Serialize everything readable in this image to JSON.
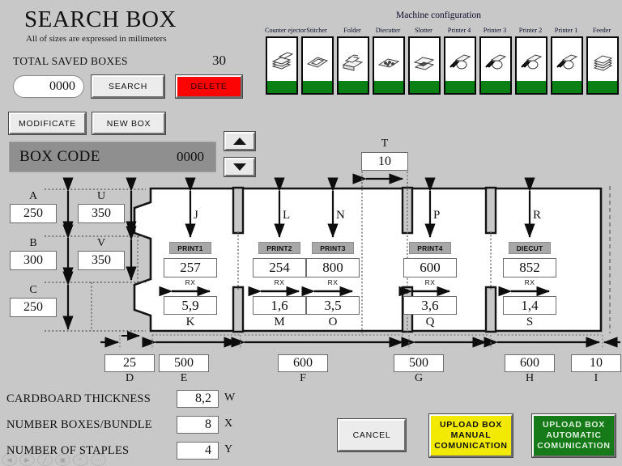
{
  "header": {
    "title": "SEARCH BOX",
    "subtitle": "All of sizes are expressed in milimeters",
    "total_label": "TOTAL SAVED BOXES",
    "total_value": "30"
  },
  "search": {
    "code_value": "0000",
    "code_placeholder": "0000",
    "search_label": "SEARCH",
    "delete_label": "DELETE",
    "delete_color": "#fc0404"
  },
  "actions": {
    "modificate_label": "MODIFICATE",
    "newbox_label": "NEW BOX",
    "cancel_label": "CANCEL",
    "upload_manual_label": "UPLOAD BOX MANUAL COMUNICATION",
    "upload_manual_lines": [
      "UPLOAD BOX",
      "MANUAL",
      "COMUNICATION"
    ],
    "upload_auto_label": "UPLOAD BOX AUTOMATIC COMUNICATION",
    "upload_auto_lines": [
      "UPLOAD BOX",
      "AUTOMATIC",
      "COMUNICATION"
    ],
    "upload_manual_color": "#f2ea03",
    "upload_auto_color": "#157a17"
  },
  "boxcode": {
    "label": "BOX CODE",
    "value": "0000",
    "spin_up_icon": "triangle-up-icon",
    "spin_down_icon": "triangle-down-icon"
  },
  "machine_config": {
    "title": "Machine configuration",
    "status_color": "#0b8014",
    "units": [
      {
        "name": "Counter ejector",
        "icon": "stacked-sheets-icon",
        "status": "ok"
      },
      {
        "name": "Stitcher",
        "icon": "stitcher-icon",
        "status": "ok"
      },
      {
        "name": "Folder",
        "icon": "folder-unit-icon",
        "status": "ok"
      },
      {
        "name": "Diecutter",
        "icon": "diecutter-icon",
        "status": "ok"
      },
      {
        "name": "Slotter",
        "icon": "slotter-icon",
        "status": "ok"
      },
      {
        "name": "Printer 4",
        "icon": "printer-unit-icon",
        "status": "ok"
      },
      {
        "name": "Printer 3",
        "icon": "printer-unit-icon",
        "status": "ok"
      },
      {
        "name": "Printer 2",
        "icon": "printer-unit-icon",
        "status": "ok"
      },
      {
        "name": "Printer 1",
        "icon": "printer-unit-icon",
        "status": "ok"
      },
      {
        "name": "Feeder",
        "icon": "feeder-stack-icon",
        "status": "ok"
      }
    ]
  },
  "dimensions": {
    "left": [
      {
        "tag": "A",
        "value": "250"
      },
      {
        "tag": "B",
        "value": "300"
      },
      {
        "tag": "C",
        "value": "250"
      }
    ],
    "inner_left": [
      {
        "tag": "U",
        "value": "350"
      },
      {
        "tag": "V",
        "value": "350"
      }
    ],
    "top": {
      "tag": "T",
      "value": "10"
    },
    "bottom": [
      {
        "tag": "D",
        "value": "25"
      },
      {
        "tag": "E",
        "value": "500"
      },
      {
        "tag": "F",
        "value": "600"
      },
      {
        "tag": "G",
        "value": "500"
      },
      {
        "tag": "H",
        "value": "600"
      },
      {
        "tag": "I",
        "value": "10"
      }
    ]
  },
  "panels": [
    {
      "unit": "PRINT1",
      "top_tag": "J",
      "top_value": "257",
      "rx_label": "RX",
      "bottom_tag": "K",
      "bottom_value": "5,9"
    },
    {
      "unit": "PRINT2",
      "top_tag": "L",
      "top_value": "254",
      "rx_label": "RX",
      "bottom_tag": "M",
      "bottom_value": "1,6"
    },
    {
      "unit": "PRINT3",
      "top_tag": "N",
      "top_value": "800",
      "rx_label": "RX",
      "bottom_tag": "O",
      "bottom_value": "3,5"
    },
    {
      "unit": "PRINT4",
      "top_tag": "P",
      "top_value": "600",
      "rx_label": "RX",
      "bottom_tag": "Q",
      "bottom_value": "3,6"
    },
    {
      "unit": "DIECUT",
      "top_tag": "R",
      "top_value": "852",
      "rx_label": "RX",
      "bottom_tag": "S",
      "bottom_value": "1,4"
    }
  ],
  "settings": [
    {
      "label": "CARDBOARD THICKNESS",
      "value": "8,2",
      "tag": "W"
    },
    {
      "label": "NUMBER BOXES/BUNDLE",
      "value": "8",
      "tag": "X"
    },
    {
      "label": "NUMBER OF STAPLES",
      "value": "4",
      "tag": "Y"
    }
  ],
  "mini_toolbar": [
    {
      "icon": "back-arrow-icon",
      "glyph": "◀"
    },
    {
      "icon": "forward-arrow-icon",
      "glyph": "▶"
    },
    {
      "icon": "pencil-icon",
      "glyph": "╱"
    },
    {
      "icon": "copy-icon",
      "glyph": "▣"
    },
    {
      "icon": "search-icon",
      "glyph": "⌕"
    },
    {
      "icon": "more-icon",
      "glyph": "⋯"
    }
  ]
}
